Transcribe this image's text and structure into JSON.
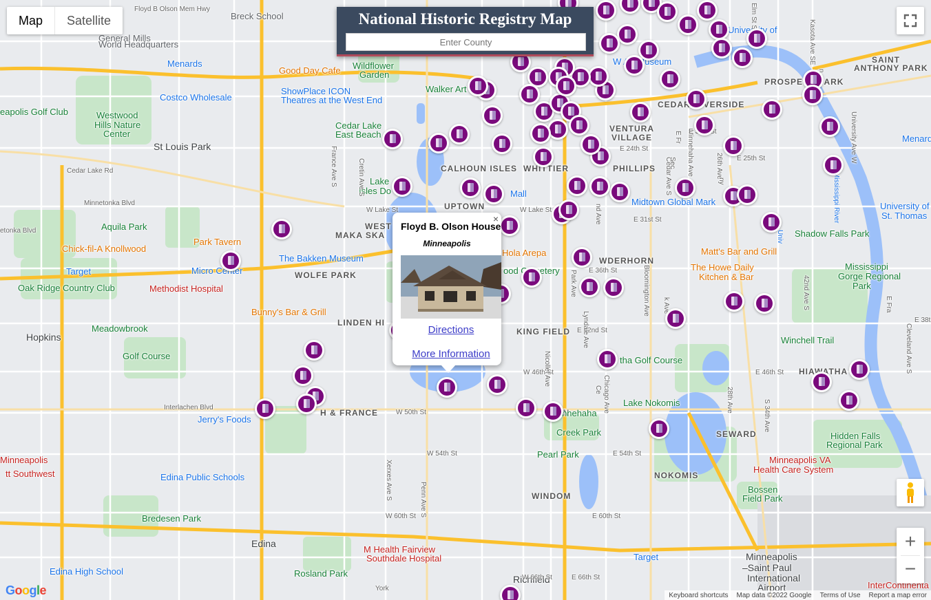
{
  "map_type": {
    "map_label": "Map",
    "satellite_label": "Satellite",
    "selected": "Map"
  },
  "header": {
    "title": "National Historic Registry Map",
    "county_placeholder": "Enter County"
  },
  "info_window": {
    "name": "Floyd B. Olson House",
    "city": "Minneapolis",
    "close": "×",
    "directions": "Directions",
    "more_info": "More Information"
  },
  "controls": {
    "fullscreen": "fullscreen-icon",
    "pegman": "pegman-icon",
    "zoom_in": "+",
    "zoom_out": "−"
  },
  "footer": {
    "keyboard": "Keyboard shortcuts",
    "map_data": "Map data ©2022 Google",
    "terms": "Terms of Use",
    "report": "Report a map error"
  },
  "google_logo": "Google",
  "map_labels": [
    {
      "text": "Floyd B Olson Mem Hwy",
      "cls": "street"
    },
    {
      "text": "Breck School",
      "cls": ""
    },
    {
      "text": "General Mills",
      "cls": ""
    },
    {
      "text": "World Headquarters",
      "cls": ""
    },
    {
      "text": "Menards",
      "cls": "poi-blue"
    },
    {
      "text": "Good Day Cafe",
      "cls": "poi-orange"
    },
    {
      "text": "Wildflower",
      "cls": "poi-green"
    },
    {
      "text": "Garden",
      "cls": "poi-green"
    },
    {
      "text": "Walker Art",
      "cls": "poi-green"
    },
    {
      "text": "Costco Wholesale",
      "cls": "poi-blue"
    },
    {
      "text": "ShowPlace ICON",
      "cls": "poi-blue"
    },
    {
      "text": "Theatres at the West End",
      "cls": "poi-blue"
    },
    {
      "text": "eapolis Golf Club",
      "cls": "poi-green"
    },
    {
      "text": "Westwood",
      "cls": "poi-green"
    },
    {
      "text": "Hills Nature",
      "cls": "poi-green"
    },
    {
      "text": "Center",
      "cls": "poi-green"
    },
    {
      "text": "Cedar Lake",
      "cls": "poi-green"
    },
    {
      "text": "East Beach",
      "cls": "poi-green"
    },
    {
      "text": "St Louis Park",
      "cls": "big"
    },
    {
      "text": "Cedar Lake Rd",
      "cls": "street"
    },
    {
      "text": "Minnetonka Blvd",
      "cls": "street"
    },
    {
      "text": "CALHOUN ISLES",
      "cls": "nbhd"
    },
    {
      "text": "WHITTIER",
      "cls": "nbhd"
    },
    {
      "text": "PHILLIPS",
      "cls": "nbhd"
    },
    {
      "text": "VENTURA",
      "cls": "nbhd"
    },
    {
      "text": "VILLAGE",
      "cls": "nbhd"
    },
    {
      "text": "CEDAR-RIVERSIDE",
      "cls": "nbhd"
    },
    {
      "text": "W Art Museum",
      "cls": "poi-blue"
    },
    {
      "text": "PROSPECT PARK",
      "cls": "nbhd"
    },
    {
      "text": "SAINT",
      "cls": "nbhd"
    },
    {
      "text": "ANTHONY PARK",
      "cls": "nbhd"
    },
    {
      "text": "University of",
      "cls": "poi-blue"
    },
    {
      "text": "Menards",
      "cls": "poi-blue"
    },
    {
      "text": "E 24th St",
      "cls": "street"
    },
    {
      "text": "E 25th St",
      "cls": "street"
    },
    {
      "text": "Lake",
      "cls": "poi-green"
    },
    {
      "text": "Isles Do",
      "cls": "poi-green"
    },
    {
      "text": "UPTOWN",
      "cls": "nbhd"
    },
    {
      "text": "W Lake St",
      "cls": "street"
    },
    {
      "text": "W Lake St",
      "cls": "street"
    },
    {
      "text": "Mall",
      "cls": "poi-blue"
    },
    {
      "text": "Midtown Global Mark",
      "cls": "poi-blue"
    },
    {
      "text": "E 31st St",
      "cls": "street"
    },
    {
      "text": "Aquila Park",
      "cls": "poi-green"
    },
    {
      "text": "etonka Blvd",
      "cls": "street"
    },
    {
      "text": "WEST",
      "cls": "nbhd"
    },
    {
      "text": "MAKA SKA",
      "cls": "nbhd"
    },
    {
      "text": "Park Tavern",
      "cls": "poi-orange"
    },
    {
      "text": "Chick-fil-A Knollwood",
      "cls": "poi-orange"
    },
    {
      "text": "The Bakken Museum",
      "cls": "poi-blue"
    },
    {
      "text": "Hola Arepa",
      "cls": "poi-orange"
    },
    {
      "text": "WDERHORN",
      "cls": "nbhd"
    },
    {
      "text": "Matt's Bar and Grill",
      "cls": "poi-orange"
    },
    {
      "text": "University of",
      "cls": "poi-blue"
    },
    {
      "text": "St. Thomas",
      "cls": "poi-blue"
    },
    {
      "text": "Shadow Falls Park",
      "cls": "poi-green"
    },
    {
      "text": "Target",
      "cls": "poi-blue"
    },
    {
      "text": "Micro Center",
      "cls": "poi-blue"
    },
    {
      "text": "WOLFE PARK",
      "cls": "nbhd"
    },
    {
      "text": "ood Cemetery",
      "cls": "poi-green"
    },
    {
      "text": "E 36th St",
      "cls": "street"
    },
    {
      "text": "The Howe Daily",
      "cls": "poi-orange"
    },
    {
      "text": "Kitchen & Bar",
      "cls": "poi-orange"
    },
    {
      "text": "Mississippi",
      "cls": "poi-green"
    },
    {
      "text": "Gorge Regional",
      "cls": "poi-green"
    },
    {
      "text": "Park",
      "cls": "poi-green"
    },
    {
      "text": "Oak Ridge Country Club",
      "cls": "poi-green"
    },
    {
      "text": "Methodist Hospital",
      "cls": "poi-red"
    },
    {
      "text": "Bunny's Bar & Grill",
      "cls": "poi-orange"
    },
    {
      "text": "LINDEN HI",
      "cls": "nbhd"
    },
    {
      "text": "KING FIELD",
      "cls": "nbhd"
    },
    {
      "text": "E 42nd St",
      "cls": "street"
    },
    {
      "text": "Winchell Trail",
      "cls": "poi-green"
    },
    {
      "text": "Hopkins",
      "cls": "big"
    },
    {
      "text": "Meadowbrook",
      "cls": "poi-green"
    },
    {
      "text": "Golf Course",
      "cls": "poi-green"
    },
    {
      "text": "tha Golf Course",
      "cls": "poi-green"
    },
    {
      "text": "W 46th St",
      "cls": "street"
    },
    {
      "text": "E 46th St",
      "cls": "street"
    },
    {
      "text": "HIAWATHA",
      "cls": "nbhd"
    },
    {
      "text": "Interlachen Blvd",
      "cls": "street"
    },
    {
      "text": "Jerry's Foods",
      "cls": "poi-blue"
    },
    {
      "text": "H & FRANCE",
      "cls": "nbhd"
    },
    {
      "text": "W 50th St",
      "cls": "street"
    },
    {
      "text": "OWN",
      "cls": "nbhd"
    },
    {
      "text": "nnehaha",
      "cls": "poi-green"
    },
    {
      "text": "Creek Park",
      "cls": "poi-green"
    },
    {
      "text": "Lake Nokomis",
      "cls": "poi-green"
    },
    {
      "text": "Hidden Falls",
      "cls": "poi-green"
    },
    {
      "text": "Regional Park",
      "cls": "poi-green"
    },
    {
      "text": "Minneapolis",
      "cls": "poi-red"
    },
    {
      "text": "tt Southwest",
      "cls": "poi-red"
    },
    {
      "text": "W 54th St",
      "cls": "street"
    },
    {
      "text": "Pearl Park",
      "cls": "poi-green"
    },
    {
      "text": "E 54th St",
      "cls": "street"
    },
    {
      "text": "SEWARD",
      "cls": "nbhd"
    },
    {
      "text": "Minneapolis VA",
      "cls": "poi-red"
    },
    {
      "text": "Health Care System",
      "cls": "poi-red"
    },
    {
      "text": "NOKOMIS",
      "cls": "nbhd"
    },
    {
      "text": "Edina Public Schools",
      "cls": "poi-blue"
    },
    {
      "text": "WINDOM",
      "cls": "nbhd"
    },
    {
      "text": "Bossen",
      "cls": "poi-green"
    },
    {
      "text": "Field Park",
      "cls": "poi-green"
    },
    {
      "text": "Bredesen Park",
      "cls": "poi-green"
    },
    {
      "text": "W 60th St",
      "cls": "street"
    },
    {
      "text": "E 60th St",
      "cls": "street"
    },
    {
      "text": "Edina",
      "cls": "big"
    },
    {
      "text": "M Health Fairview",
      "cls": "poi-red"
    },
    {
      "text": "Southdale Hospital",
      "cls": "poi-red"
    },
    {
      "text": "Target",
      "cls": "poi-blue"
    },
    {
      "text": "Minneapolis",
      "cls": "big"
    },
    {
      "text": "–Saint Paul",
      "cls": "big"
    },
    {
      "text": "International",
      "cls": "big"
    },
    {
      "text": "Airport",
      "cls": "big"
    },
    {
      "text": "Edina High School",
      "cls": "poi-blue"
    },
    {
      "text": "Rosland Park",
      "cls": "poi-green"
    },
    {
      "text": "Richfield",
      "cls": "big"
    },
    {
      "text": "W 66th St",
      "cls": "street"
    },
    {
      "text": "E 66th St",
      "cls": "street"
    },
    {
      "text": "InterContinenta",
      "cls": "poi-red"
    },
    {
      "text": "Elm St SE",
      "cls": "street"
    },
    {
      "text": "Kasota Ave SE",
      "cls": "street"
    },
    {
      "text": "University Ave W",
      "cls": "street"
    },
    {
      "text": "Mississippi River",
      "cls": "poi-blue"
    },
    {
      "text": "France Ave S",
      "cls": "street"
    },
    {
      "text": "Xerxes Ave S",
      "cls": "street"
    },
    {
      "text": "Penn Ave S",
      "cls": "street"
    },
    {
      "text": "Nicollet Ave",
      "cls": "street"
    },
    {
      "text": "Chicago Ave",
      "cls": "street"
    },
    {
      "text": "Bloomington Ave",
      "cls": "street"
    },
    {
      "text": "Cedar Ave S",
      "cls": "street"
    },
    {
      "text": "28th Ave",
      "cls": "street"
    },
    {
      "text": "S 34th Ave",
      "cls": "street"
    },
    {
      "text": "42nd Ave S",
      "cls": "street"
    },
    {
      "text": "Cleveland Ave S",
      "cls": "street"
    },
    {
      "text": "Minnehaha Ave",
      "cls": "street"
    },
    {
      "text": "26th Ave",
      "cls": "street"
    },
    {
      "text": "E Fra",
      "cls": "street"
    },
    {
      "text": "Cretin Ave S",
      "cls": "street"
    },
    {
      "text": "Lyndale Ave",
      "cls": "street"
    },
    {
      "text": "nd Ave",
      "cls": "street"
    },
    {
      "text": "k Ave",
      "cls": "street"
    },
    {
      "text": "Ce",
      "cls": "street"
    },
    {
      "text": "Park Ave",
      "cls": "street"
    },
    {
      "text": "E 38th St",
      "cls": "street"
    },
    {
      "text": "Univ",
      "cls": "poi-blue"
    },
    {
      "text": "n",
      "cls": "street"
    },
    {
      "text": "ny",
      "cls": "street"
    },
    {
      "text": "Sec",
      "cls": "street"
    },
    {
      "text": "E 31st St",
      "cls": "street"
    },
    {
      "text": "E Fr",
      "cls": "street"
    },
    {
      "text": "York",
      "cls": "street"
    }
  ],
  "markers_count_note": "Historic site markers shown as purple circles",
  "colors": {
    "marker": "#7a0a7c",
    "title_bg": "#3b4a5f",
    "link": "#3c3cc8",
    "water": "#9cc0f9",
    "park": "#c8e6c9",
    "freeway": "#fbc02d"
  }
}
